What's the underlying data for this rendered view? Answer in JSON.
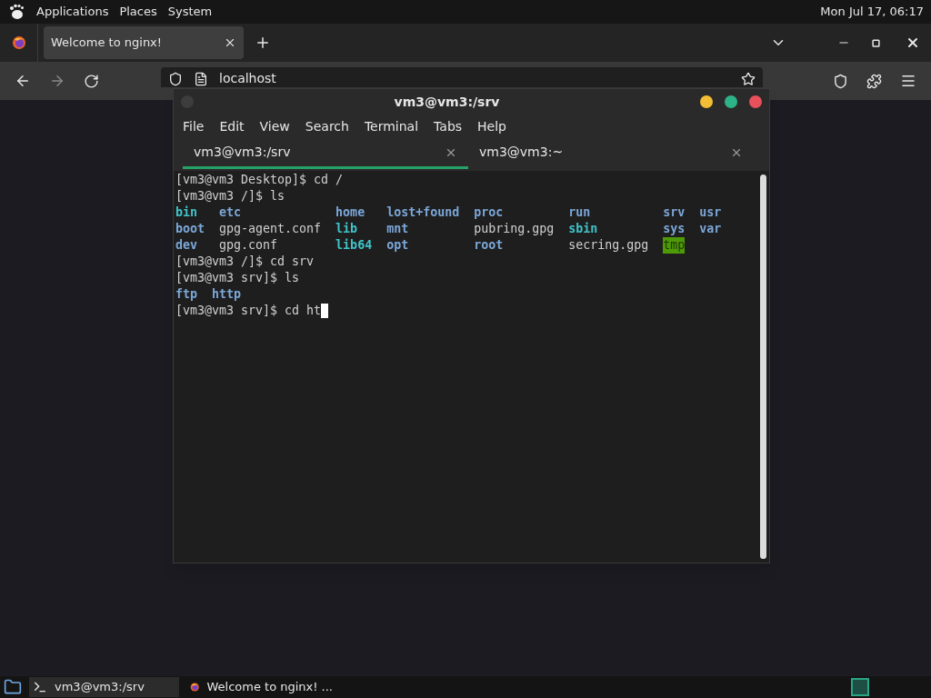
{
  "top_panel": {
    "menus": [
      "Applications",
      "Places",
      "System"
    ],
    "clock": "Mon Jul 17, 06:17"
  },
  "browser": {
    "tabs": [
      {
        "label": "Welcome to nginx!",
        "selected": true
      }
    ],
    "address": "localhost"
  },
  "terminal": {
    "title": "vm3@vm3:/srv",
    "menu": [
      "File",
      "Edit",
      "View",
      "Search",
      "Terminal",
      "Tabs",
      "Help"
    ],
    "tabs": [
      {
        "label": "vm3@vm3:/srv",
        "selected": true
      },
      {
        "label": "vm3@vm3:~",
        "selected": false
      }
    ],
    "lines": [
      {
        "kind": "text",
        "text": "[vm3@vm3 Desktop]$ cd /"
      },
      {
        "kind": "text",
        "text": "[vm3@vm3 /]$ ls"
      },
      {
        "kind": "listing",
        "columns": [
          [
            {
              "name": "bin",
              "kind": "link"
            },
            {
              "name": "boot",
              "kind": "dir"
            },
            {
              "name": "dev",
              "kind": "dir"
            }
          ],
          [
            {
              "name": "etc",
              "kind": "dir"
            },
            {
              "name": "gpg-agent.conf",
              "kind": "file"
            },
            {
              "name": "gpg.conf",
              "kind": "file"
            }
          ],
          [
            {
              "name": "home",
              "kind": "dir"
            },
            {
              "name": "lib",
              "kind": "link"
            },
            {
              "name": "lib64",
              "kind": "link"
            }
          ],
          [
            {
              "name": "lost+found",
              "kind": "dir"
            },
            {
              "name": "mnt",
              "kind": "dir"
            },
            {
              "name": "opt",
              "kind": "dir"
            }
          ],
          [
            {
              "name": "proc",
              "kind": "dir"
            },
            {
              "name": "pubring.gpg",
              "kind": "file"
            },
            {
              "name": "root",
              "kind": "dir"
            }
          ],
          [
            {
              "name": "run",
              "kind": "dir"
            },
            {
              "name": "sbin",
              "kind": "link"
            },
            {
              "name": "secring.gpg",
              "kind": "file"
            }
          ],
          [
            {
              "name": "srv",
              "kind": "dir"
            },
            {
              "name": "sys",
              "kind": "dir"
            },
            {
              "name": "tmp",
              "kind": "sticky"
            }
          ],
          [
            {
              "name": "usr",
              "kind": "dir"
            },
            {
              "name": "var",
              "kind": "dir"
            }
          ]
        ]
      },
      {
        "kind": "text",
        "text": "[vm3@vm3 /]$ cd srv"
      },
      {
        "kind": "text",
        "text": "[vm3@vm3 srv]$ ls"
      },
      {
        "kind": "listing",
        "columns": [
          [
            {
              "name": "ftp",
              "kind": "dir"
            }
          ],
          [
            {
              "name": "http",
              "kind": "dir"
            }
          ]
        ]
      },
      {
        "kind": "prompt",
        "text": "[vm3@vm3 srv]$ cd ht"
      }
    ]
  },
  "taskbar": {
    "windows": [
      {
        "label": "vm3@vm3:/srv",
        "kind": "terminal",
        "selected": true
      },
      {
        "label": "Welcome to nginx! ...",
        "kind": "browser",
        "selected": false
      }
    ]
  }
}
